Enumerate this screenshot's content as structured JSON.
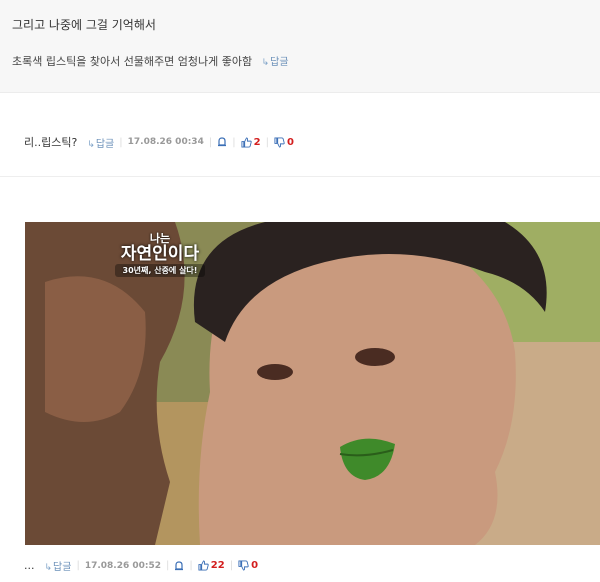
{
  "comment1": {
    "line1": "그리고 나중에 그걸 기억해서",
    "line2": "초록색 립스틱을 찾아서 선물해주면 엄청나게 좋아함",
    "reply_label": "답글"
  },
  "comment2": {
    "text": "리..립스틱?",
    "reply_label": "답글",
    "date": "17.08.26 00:34",
    "up": "2",
    "down": "0"
  },
  "comment3": {
    "text": "...",
    "reply_label": "답글",
    "date": "17.08.26 00:52",
    "up": "22",
    "down": "0"
  },
  "photo": {
    "logo_line1": "나는",
    "logo_line2": "자연인이다",
    "logo_caption": "30년째, 산중에 살다!"
  },
  "colors": {
    "reply": "#6a8fb8",
    "count": "#d31e1e",
    "thumb": "#3b6fb6"
  },
  "icons": [
    "reply-arrow-icon",
    "report-icon",
    "thumbs-up-icon",
    "thumbs-down-icon"
  ]
}
